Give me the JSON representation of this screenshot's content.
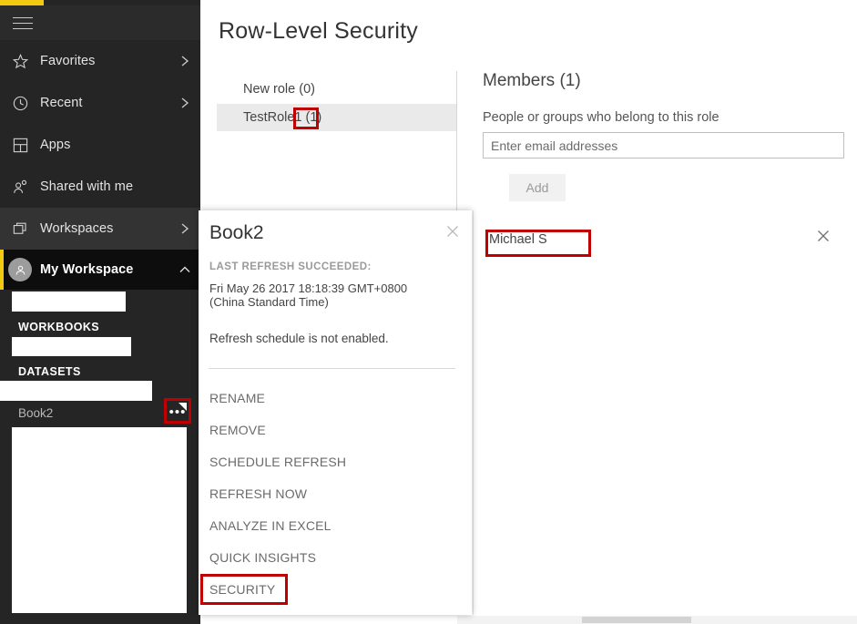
{
  "colors": {
    "brand_yellow": "#f2c811",
    "nav_background": "#252525",
    "nav_selected": "#0d0d0d",
    "nav_hover": "#333333",
    "annotation_red": "#c00000",
    "row_highlight": "#eaeaea"
  },
  "sidebar": {
    "menu_icon": "hamburger-icon",
    "items": [
      {
        "label": "Favorites",
        "icon": "star-icon",
        "chevron": true,
        "name": "favorites"
      },
      {
        "label": "Recent",
        "icon": "clock-icon",
        "chevron": true,
        "name": "recent"
      },
      {
        "label": "Apps",
        "icon": "apps-grid-icon",
        "chevron": false,
        "name": "apps"
      },
      {
        "label": "Shared with me",
        "icon": "person-share-icon",
        "chevron": false,
        "name": "shared-with-me"
      },
      {
        "label": "Workspaces",
        "icon": "stacked-windows-icon",
        "chevron": true,
        "name": "workspaces"
      }
    ],
    "workspace": {
      "label": "My Workspace",
      "icon": "user-avatar-icon",
      "chevron": "chevron-up-icon",
      "expanded": true
    },
    "groups": [
      {
        "heading": "WORKBOOKS"
      },
      {
        "heading": "DATASETS"
      }
    ],
    "datasets": [
      {
        "label": "Book2",
        "more_icon": "ellipsis-icon"
      }
    ]
  },
  "main": {
    "page_title": "Row-Level Security",
    "roles": [
      {
        "label": "New role (0)"
      },
      {
        "label": "TestRole1 (1)",
        "selected": true
      }
    ],
    "members": {
      "title": "Members (1)",
      "subtitle": "People or groups who belong to this role",
      "input_value": "",
      "input_placeholder": "Enter email addresses",
      "add_label": "Add",
      "list": [
        {
          "name": "Michael S",
          "remove_icon": "close-icon"
        }
      ]
    }
  },
  "flyout": {
    "title": "Book2",
    "close_icon": "close-icon",
    "status_label": "LAST REFRESH SUCCEEDED:",
    "status_time": "Fri May 26 2017 18:18:39 GMT+0800 (China Standard Time)",
    "schedule_text": "Refresh schedule is not enabled.",
    "menu_items": [
      {
        "label": "RENAME",
        "name": "rename"
      },
      {
        "label": "REMOVE",
        "name": "remove"
      },
      {
        "label": "SCHEDULE REFRESH",
        "name": "schedule-refresh"
      },
      {
        "label": "REFRESH NOW",
        "name": "refresh-now"
      },
      {
        "label": "ANALYZE IN EXCEL",
        "name": "analyze-in-excel"
      },
      {
        "label": "QUICK INSIGHTS",
        "name": "quick-insights"
      },
      {
        "label": "SECURITY",
        "name": "security"
      }
    ]
  },
  "annotations": [
    {
      "name": "role-member-count-highlight"
    },
    {
      "name": "dataset-ellipsis-highlight"
    },
    {
      "name": "security-menu-highlight"
    },
    {
      "name": "member-name-highlight"
    }
  ]
}
